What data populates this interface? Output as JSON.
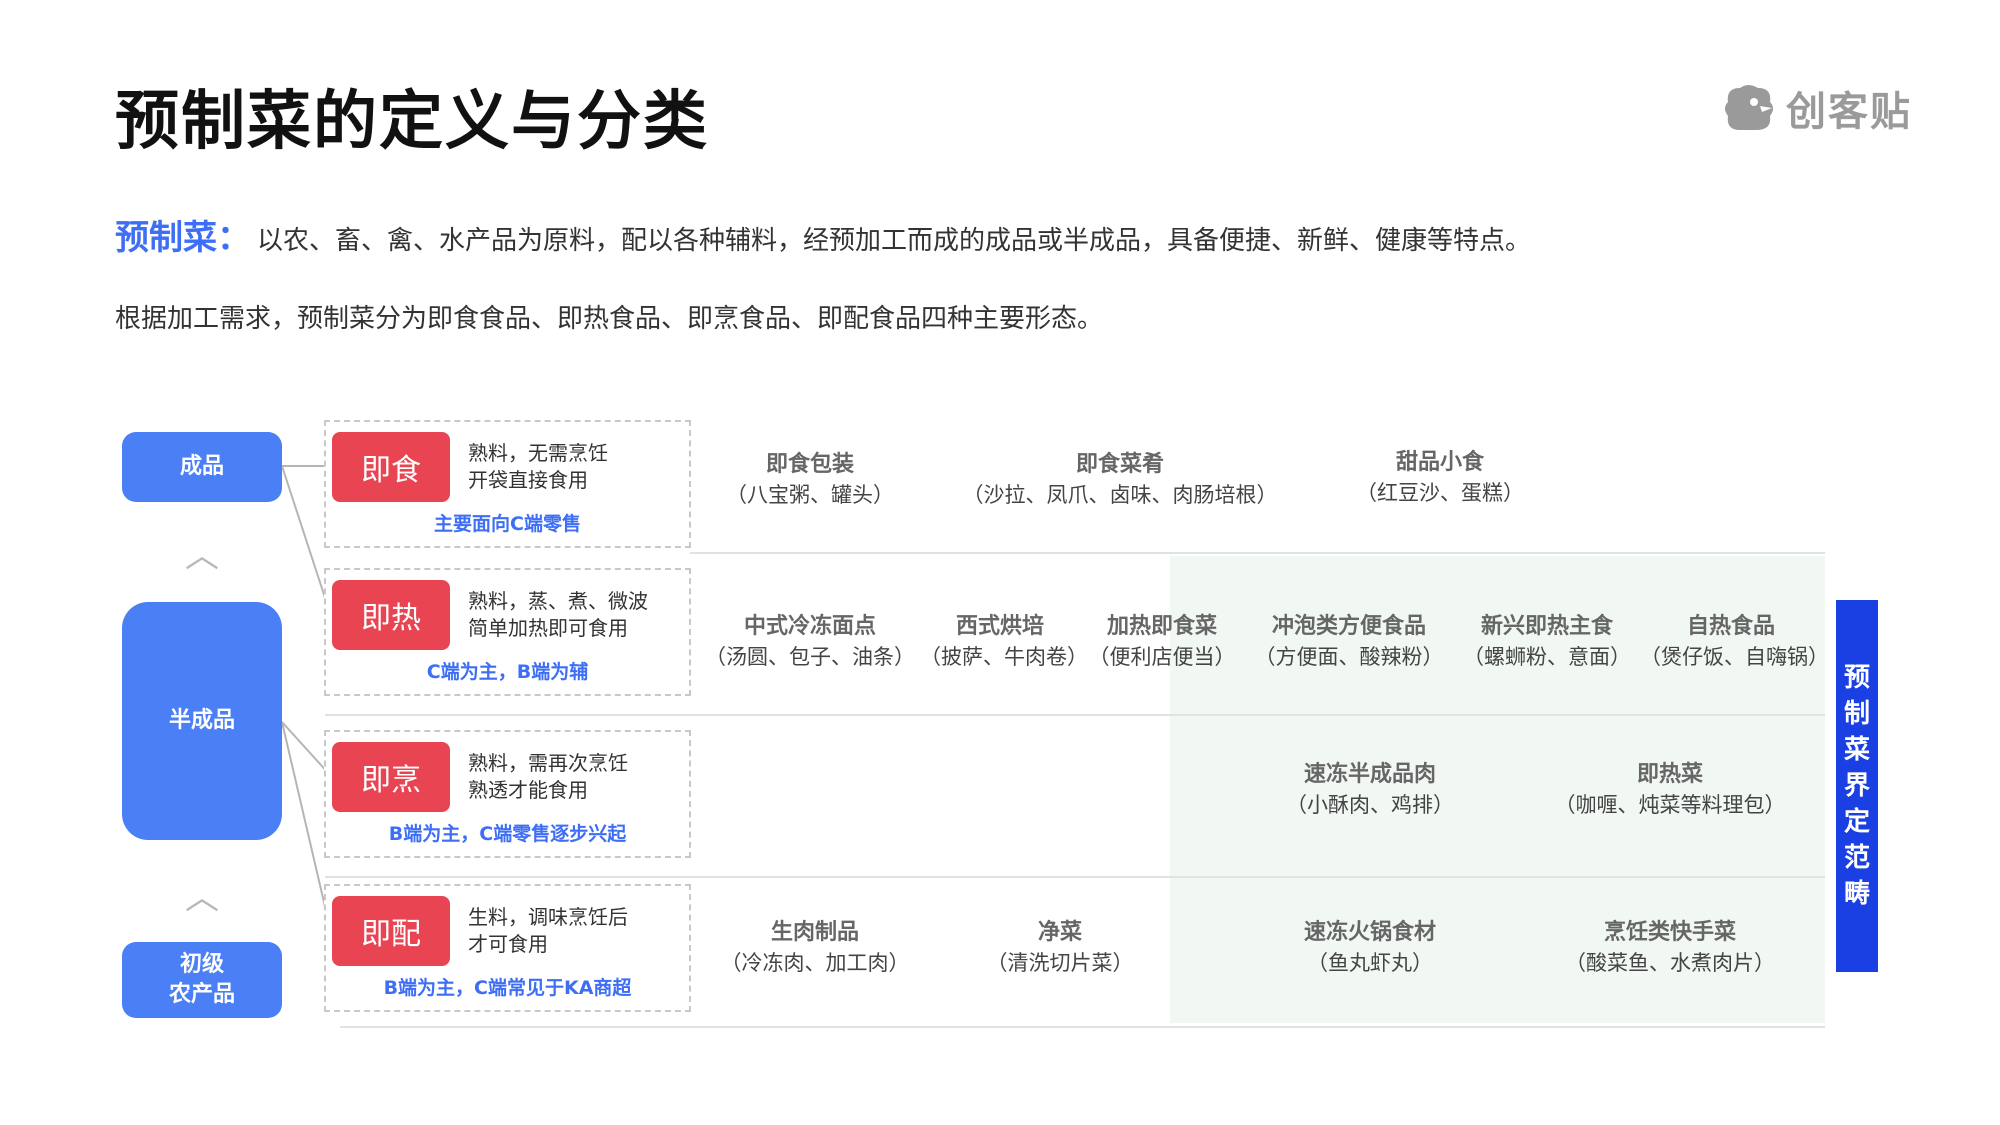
{
  "title": "预制菜的定义与分类",
  "logo": {
    "icon": "bird-logo-icon",
    "text": "创客贴"
  },
  "definition": {
    "term": "预制菜：",
    "text": "以农、畜、禽、水产品为原料，配以各种辅料，经预加工而成的成品或半成品，具备便捷、新鲜、健康等特点。"
  },
  "paragraph2": "根据加工需求，预制菜分为即食食品、即热食品、即烹食品、即配食品四种主要形态。",
  "stages": {
    "finished": "成品",
    "semi": "半成品",
    "raw_line1": "初级",
    "raw_line2": "农产品"
  },
  "types": [
    {
      "tag": "即食",
      "desc1": "熟料，无需烹饪",
      "desc2": "开袋直接食用",
      "note": "主要面向C端零售"
    },
    {
      "tag": "即热",
      "desc1": "熟料，蒸、煮、微波",
      "desc2": "简单加热即可食用",
      "note": "C端为主，B端为辅"
    },
    {
      "tag": "即烹",
      "desc1": "熟料，需再次烹饪",
      "desc2": "熟透才能食用",
      "note": "B端为主，C端零售逐步兴起"
    },
    {
      "tag": "即配",
      "desc1": "生料，调味烹饪后",
      "desc2": "才可食用",
      "note": "B端为主，C端常见于KA商超"
    }
  ],
  "categories": {
    "row1": [
      {
        "name": "即食包装",
        "detail": "（八宝粥、罐头）"
      },
      {
        "name": "即食菜肴",
        "detail": "（沙拉、凤爪、卤味、肉肠培根）"
      },
      {
        "name": "甜品小食",
        "detail": "（红豆沙、蛋糕）"
      }
    ],
    "row2": [
      {
        "name": "中式冷冻面点",
        "detail": "（汤圆、包子、油条）"
      },
      {
        "name": "西式烘培",
        "detail": "（披萨、牛肉卷）"
      },
      {
        "name": "加热即食菜",
        "detail": "（便利店便当）"
      },
      {
        "name": "冲泡类方便食品",
        "detail": "（方便面、酸辣粉）"
      },
      {
        "name": "新兴即热主食",
        "detail": "（螺蛳粉、意面）"
      },
      {
        "name": "自热食品",
        "detail": "（煲仔饭、自嗨锅）"
      }
    ],
    "row3": [
      {
        "name": "速冻半成品肉",
        "detail": "（小酥肉、鸡排）"
      },
      {
        "name": "即热菜",
        "detail": "（咖喱、炖菜等料理包）"
      }
    ],
    "row4": [
      {
        "name": "生肉制品",
        "detail": "（冷冻肉、加工肉）"
      },
      {
        "name": "净菜",
        "detail": "（清洗切片菜）"
      },
      {
        "name": "速冻火锅食材",
        "detail": "（鱼丸虾丸）"
      },
      {
        "name": "烹饪类快手菜",
        "detail": "（酸菜鱼、水煮肉片）"
      }
    ]
  },
  "scope": [
    "预",
    "制",
    "菜",
    "界",
    "定",
    "范",
    "畴"
  ],
  "colors": {
    "accent_blue": "#4a7ff5",
    "tag_red": "#e94452",
    "scope_blue": "#1a3fe3",
    "green_area": "#f1f8f3"
  }
}
